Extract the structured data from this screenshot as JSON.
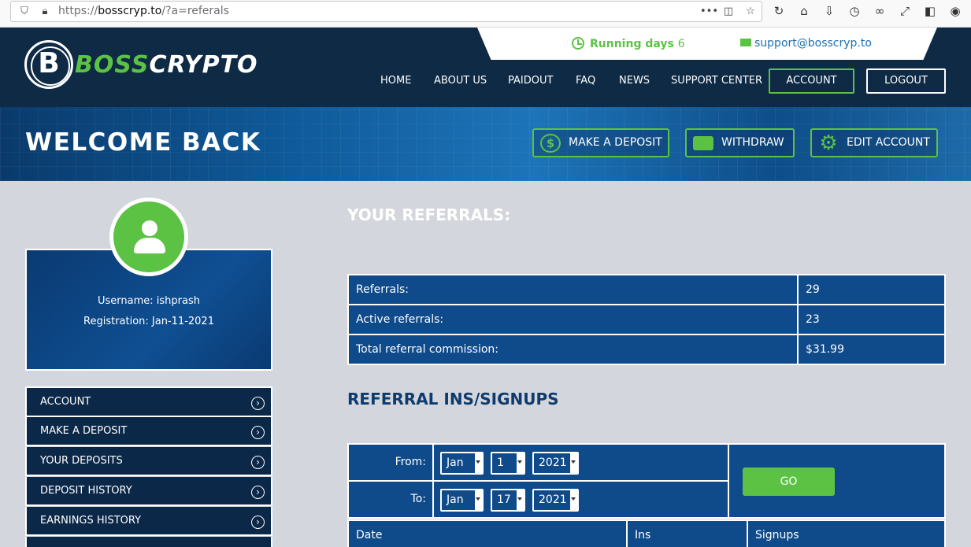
{
  "browser": {
    "url_prefix": "https://",
    "url_host": "bosscryp.to",
    "url_path": "/?a=referals"
  },
  "header": {
    "logo_letter": "B",
    "logo_boss": "BOSS",
    "logo_crypto": "CRYPTO",
    "running_label": "Running days",
    "running_days": "6",
    "support_email": "support@bosscryp.to",
    "nav": [
      "HOME",
      "ABOUT US",
      "PAIDOUT",
      "FAQ",
      "NEWS",
      "SUPPORT CENTER"
    ],
    "account_label": "ACCOUNT",
    "logout_label": "LOGOUT"
  },
  "banner": {
    "welcome": "WELCOME BACK",
    "make_deposit": "MAKE A DEPOSIT",
    "withdraw": "WITHDRAW",
    "edit_account": "EDIT ACCOUNT"
  },
  "profile": {
    "username": "Username: ishprash",
    "registration": "Registration: Jan-11-2021"
  },
  "sidebar": {
    "items": [
      "ACCOUNT",
      "MAKE A DEPOSIT",
      "YOUR DEPOSITS",
      "DEPOSIT HISTORY",
      "EARNINGS HISTORY"
    ]
  },
  "referrals": {
    "title": "YOUR REFERRALS:",
    "rows": [
      {
        "label": "Referrals:",
        "value": "29"
      },
      {
        "label": "Active referrals:",
        "value": "23"
      },
      {
        "label": "Total referral commission:",
        "value": "$31.99"
      }
    ]
  },
  "signups": {
    "title": "REFERRAL INS/SIGNUPS",
    "from_label": "From:",
    "to_label": "To:",
    "from": {
      "month": "Jan",
      "day": "1",
      "year": "2021"
    },
    "to": {
      "month": "Jan",
      "day": "17",
      "year": "2021"
    },
    "go_label": "GO",
    "columns": [
      "Date",
      "Ins",
      "Signups"
    ]
  },
  "colors": {
    "accent_green": "#5cc244",
    "header_navy": "#0e2a45",
    "panel_blue": "#0f4a8a"
  }
}
